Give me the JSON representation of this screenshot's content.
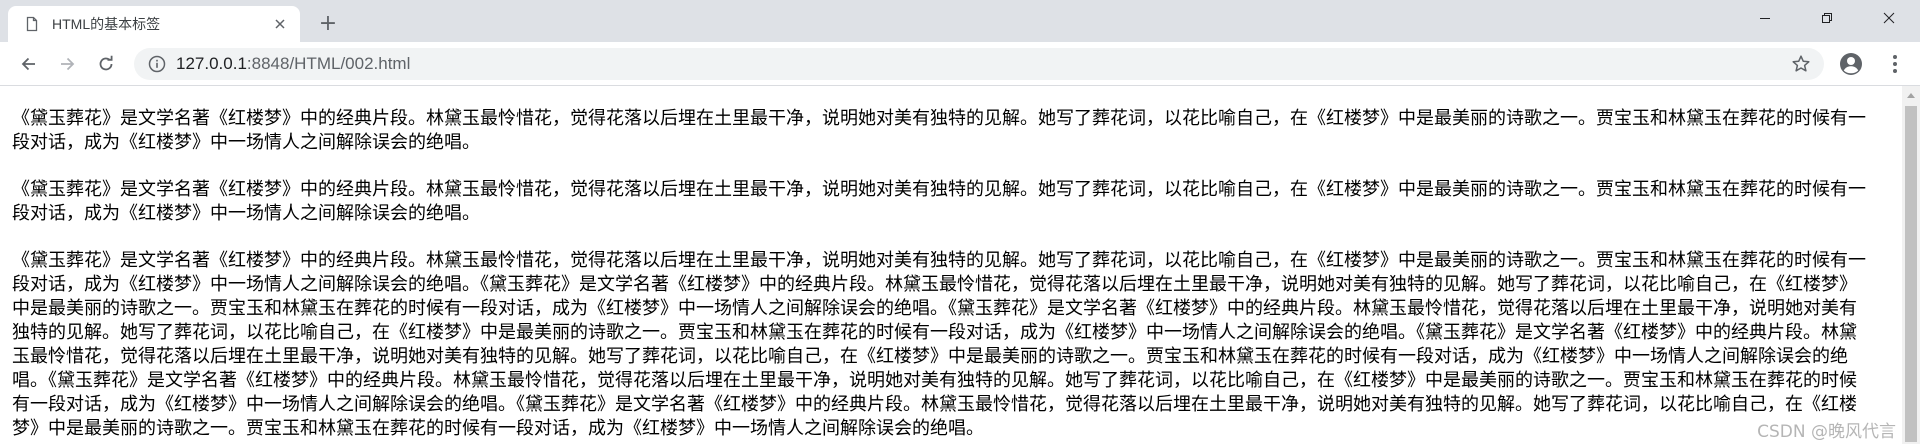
{
  "browser": {
    "tab": {
      "title": "HTML的基本标签",
      "favicon": "document-icon"
    },
    "new_tab_label": "+",
    "address": {
      "host": "127.0.0.1",
      "path": ":8848/HTML/002.html"
    }
  },
  "page": {
    "paragraphs": [
      "《黛玉葬花》是文学名著《红楼梦》中的经典片段。林黛玉最怜惜花，觉得花落以后埋在土里最干净，说明她对美有独特的见解。她写了葬花词，以花比喻自己，在《红楼梦》中是最美丽的诗歌之一。贾宝玉和林黛玉在葬花的时候有一段对话，成为《红楼梦》中一场情人之间解除误会的绝唱。",
      "《黛玉葬花》是文学名著《红楼梦》中的经典片段。林黛玉最怜惜花，觉得花落以后埋在土里最干净，说明她对美有独特的见解。她写了葬花词，以花比喻自己，在《红楼梦》中是最美丽的诗歌之一。贾宝玉和林黛玉在葬花的时候有一段对话，成为《红楼梦》中一场情人之间解除误会的绝唱。",
      "《黛玉葬花》是文学名著《红楼梦》中的经典片段。林黛玉最怜惜花，觉得花落以后埋在土里最干净，说明她对美有独特的见解。她写了葬花词，以花比喻自己，在《红楼梦》中是最美丽的诗歌之一。贾宝玉和林黛玉在葬花的时候有一段对话，成为《红楼梦》中一场情人之间解除误会的绝唱。《黛玉葬花》是文学名著《红楼梦》中的经典片段。林黛玉最怜惜花，觉得花落以后埋在土里最干净，说明她对美有独特的见解。她写了葬花词，以花比喻自己，在《红楼梦》中是最美丽的诗歌之一。贾宝玉和林黛玉在葬花的时候有一段对话，成为《红楼梦》中一场情人之间解除误会的绝唱。《黛玉葬花》是文学名著《红楼梦》中的经典片段。林黛玉最怜惜花，觉得花落以后埋在土里最干净，说明她对美有独特的见解。她写了葬花词，以花比喻自己，在《红楼梦》中是最美丽的诗歌之一。贾宝玉和林黛玉在葬花的时候有一段对话，成为《红楼梦》中一场情人之间解除误会的绝唱。《黛玉葬花》是文学名著《红楼梦》中的经典片段。林黛玉最怜惜花，觉得花落以后埋在土里最干净，说明她对美有独特的见解。她写了葬花词，以花比喻自己，在《红楼梦》中是最美丽的诗歌之一。贾宝玉和林黛玉在葬花的时候有一段对话，成为《红楼梦》中一场情人之间解除误会的绝唱。《黛玉葬花》是文学名著《红楼梦》中的经典片段。林黛玉最怜惜花，觉得花落以后埋在土里最干净，说明她对美有独特的见解。她写了葬花词，以花比喻自己，在《红楼梦》中是最美丽的诗歌之一。贾宝玉和林黛玉在葬花的时候有一段对话，成为《红楼梦》中一场情人之间解除误会的绝唱。《黛玉葬花》是文学名著《红楼梦》中的经典片段。林黛玉最怜惜花，觉得花落以后埋在土里最干净，说明她对美有独特的见解。她写了葬花词，以花比喻自己，在《红楼梦》中是最美丽的诗歌之一。贾宝玉和林黛玉在葬花的时候有一段对话，成为《红楼梦》中一场情人之间解除误会的绝唱。"
    ]
  },
  "watermark": "CSDN @晚风代言",
  "colors": {
    "tab_strip": "#dee1e6",
    "omnibox": "#f1f3f4",
    "text": "#000000"
  }
}
